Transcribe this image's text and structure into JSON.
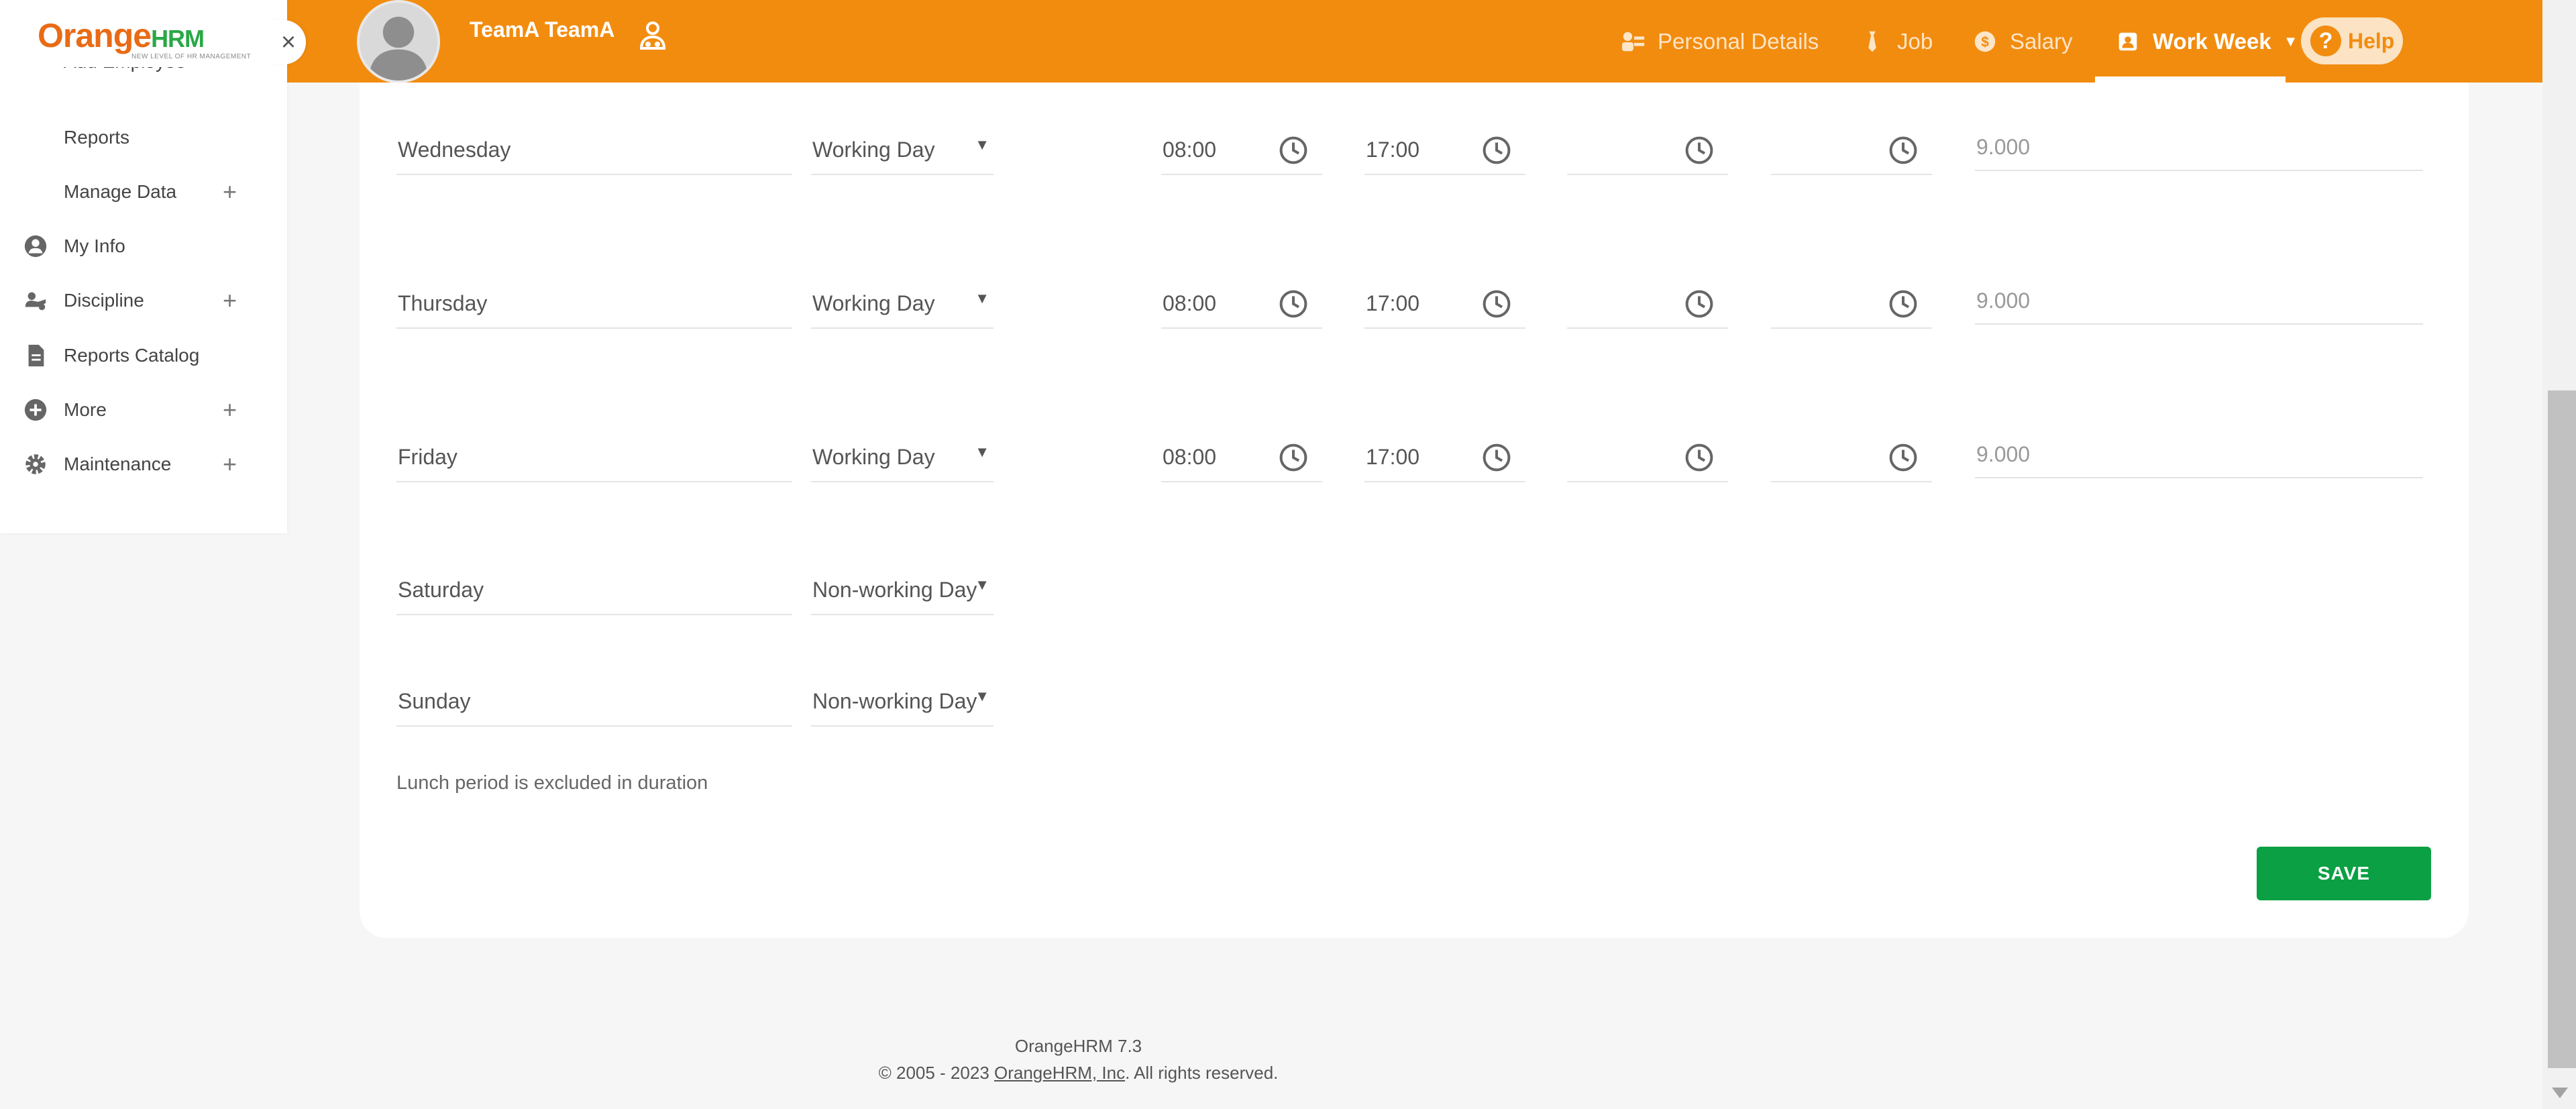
{
  "header": {
    "user_name": "TeamA TeamA",
    "nav": [
      {
        "label": "Personal Details",
        "icon": "id-card-icon"
      },
      {
        "label": "Job",
        "icon": "tie-icon"
      },
      {
        "label": "Salary",
        "icon": "dollar-icon"
      },
      {
        "label": "Work Week",
        "icon": "calendar-person-icon",
        "active": true
      }
    ],
    "help_label": "Help"
  },
  "sidebar": {
    "logo_main": "Orange",
    "logo_suffix": "HRM",
    "logo_sub": "NEW LEVEL OF HR MANAGEMENT",
    "clipped_item": "Add Employee",
    "items": [
      {
        "label": "Reports",
        "has_plus": false
      },
      {
        "label": "Manage Data",
        "has_plus": true
      },
      {
        "label": "My Info",
        "icon": "user-circle-icon",
        "has_plus": false
      },
      {
        "label": "Discipline",
        "icon": "discipline-icon",
        "has_plus": true
      },
      {
        "label": "Reports Catalog",
        "icon": "document-icon",
        "has_plus": false
      },
      {
        "label": "More",
        "icon": "plus-circle-icon",
        "has_plus": true
      },
      {
        "label": "Maintenance",
        "icon": "gear-icon",
        "has_plus": true
      }
    ]
  },
  "work_week": {
    "days": [
      {
        "day": "Wednesday",
        "type": "Working Day",
        "start": "08:00",
        "end": "17:00",
        "duration": "9.000"
      },
      {
        "day": "Thursday",
        "type": "Working Day",
        "start": "08:00",
        "end": "17:00",
        "duration": "9.000"
      },
      {
        "day": "Friday",
        "type": "Working Day",
        "start": "08:00",
        "end": "17:00",
        "duration": "9.000"
      },
      {
        "day": "Saturday",
        "type": "Non-working Day"
      },
      {
        "day": "Sunday",
        "type": "Non-working Day"
      }
    ],
    "note": "Lunch period is excluded in duration",
    "save_label": "SAVE"
  },
  "footer": {
    "version": "OrangeHRM 7.3",
    "copyright_prefix": "© 2005 - 2023 ",
    "company_link": "OrangeHRM, Inc",
    "copyright_suffix": ". All rights reserved."
  },
  "colors": {
    "brand_orange": "#f28c0f",
    "save_green": "#0aa043"
  }
}
